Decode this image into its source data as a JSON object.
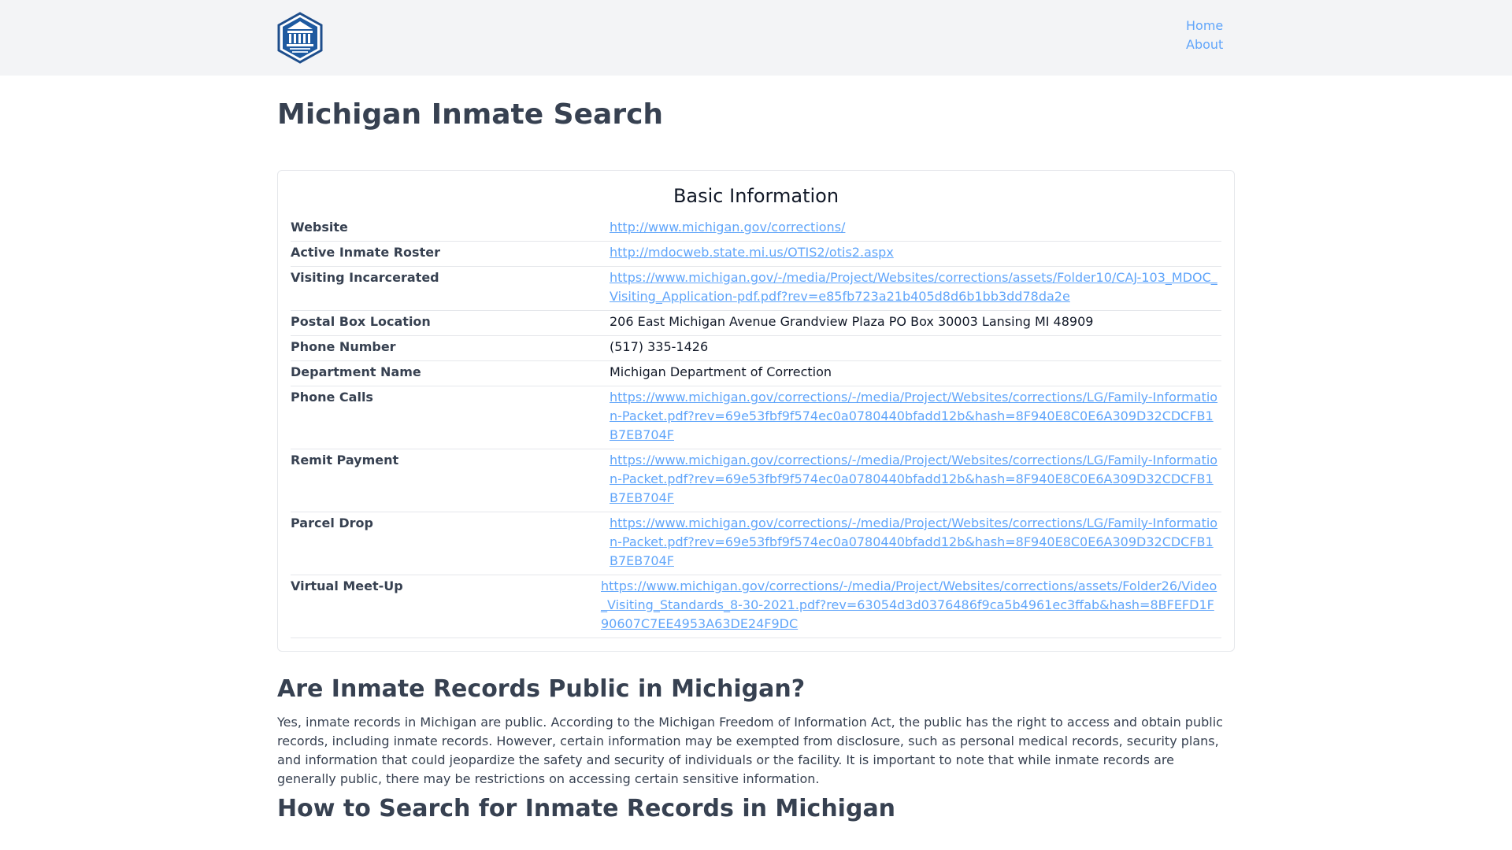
{
  "header": {
    "logo_icon": "county-seal-icon",
    "nav": [
      {
        "label": "Home"
      },
      {
        "label": "About"
      }
    ]
  },
  "main": {
    "title": "Michigan Inmate Search",
    "card": {
      "title": "Basic Information",
      "rows": [
        {
          "label": "Website",
          "value": "http://www.michigan.gov/corrections/",
          "link": true
        },
        {
          "label": "Active Inmate Roster",
          "value": "http://mdocweb.state.mi.us/OTIS2/otis2.aspx",
          "link": true
        },
        {
          "label": "Visiting Incarcerated",
          "value": "https://www.michigan.gov/-/media/Project/Websites/corrections/assets/Folder10/CAJ-103_MDOC_Visiting_Application-pdf.pdf?rev=e85fb723a21b405d8d6b1bb3dd78da2e",
          "link": true
        },
        {
          "label": "Postal Box Location",
          "value": "206 East Michigan Avenue Grandview Plaza PO Box 30003 Lansing MI 48909",
          "link": false
        },
        {
          "label": "Phone Number",
          "value": "(517) 335-1426",
          "link": false
        },
        {
          "label": "Department Name",
          "value": "Michigan Department of Correction",
          "link": false
        },
        {
          "label": "Phone Calls",
          "value": "https://www.michigan.gov/corrections/-/media/Project/Websites/corrections/LG/Family-Information-Packet.pdf?rev=69e53fbf9f574ec0a0780440bfadd12b&hash=8F940E8C0E6A309D32CDCFB1B7EB704F",
          "link": true
        },
        {
          "label": "Remit Payment",
          "value": "https://www.michigan.gov/corrections/-/media/Project/Websites/corrections/LG/Family-Information-Packet.pdf?rev=69e53fbf9f574ec0a0780440bfadd12b&hash=8F940E8C0E6A309D32CDCFB1B7EB704F",
          "link": true
        },
        {
          "label": "Parcel Drop",
          "value": "https://www.michigan.gov/corrections/-/media/Project/Websites/corrections/LG/Family-Information-Packet.pdf?rev=69e53fbf9f574ec0a0780440bfadd12b&hash=8F940E8C0E6A309D32CDCFB1B7EB704F",
          "link": true
        },
        {
          "label": "Virtual Meet-Up",
          "value": "https://www.michigan.gov/corrections/-/media/Project/Websites/corrections/assets/Folder26/Video_Visiting_Standards_8-30-2021.pdf?rev=63054d3d0376486f9ca5b4961ec3ffab&hash=8BFEFD1F90607C7EE4953A63DE24F9DC",
          "link": true
        }
      ]
    },
    "section1": {
      "heading": "Are Inmate Records Public in Michigan?",
      "body": "Yes, inmate records in Michigan are public. According to the Michigan Freedom of Information Act, the public has the right to access and obtain public records, including inmate records. However, certain information may be exempted from disclosure, such as personal medical records, security plans, and information that could jeopardize the safety and security of individuals or the facility. It is important to note that while inmate records are generally public, there may be restrictions on accessing certain sensitive information."
    },
    "section2": {
      "heading": "How to Search for Inmate Records in Michigan"
    }
  },
  "colors": {
    "link": "#60a5fa",
    "header_bg": "#f3f4f6",
    "text": "#374151"
  }
}
